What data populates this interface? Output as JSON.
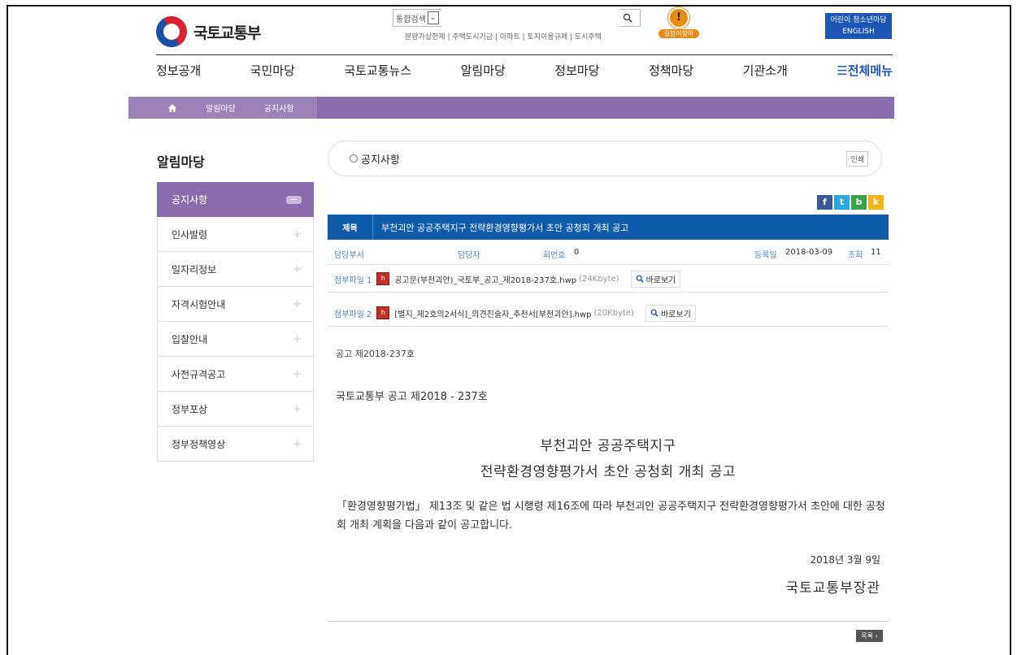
{
  "header": {
    "logo_text": "국토교통부",
    "search_scope": "통합검색",
    "search_placeholder": "",
    "quick_links": "분양가상한제 | 주택도시기금 | 아파트 | 토지이용규제 | 도시주택",
    "badge_label": "길잡이찾아",
    "youth_link": "어린이 청소년마당",
    "english_link": "ENGLISH"
  },
  "nav": [
    "정보공개",
    "국민마당",
    "국토교통뉴스",
    "알림마당",
    "정보마당",
    "정책마당",
    "기관소개"
  ],
  "nav_all": "☰전체메뉴",
  "breadcrumb": [
    "알림마당",
    "공지사항"
  ],
  "sidebar": {
    "title": "알림마당",
    "items": [
      "공지사항",
      "인사발령",
      "일자리정보",
      "자격시험안내",
      "입찰안내",
      "사전규격공고",
      "정부포상",
      "정부정책영상"
    ]
  },
  "content": {
    "section_title": "공지사항",
    "print_label": "인쇄",
    "subject_label": "제목",
    "subject": "부천괴안 공공주택지구 전략환경영향평가서 초안 공청회 개최 공고",
    "dept_label": "담당부서",
    "person_label": "담당자",
    "phone_label": "회번호",
    "phone_value": "0",
    "reg_label": "등록일",
    "reg_date": "2018-03-09",
    "views_label": "조회",
    "views": "11",
    "files": [
      {
        "label": "첨부파일 1",
        "name": "공고문(부천괴안)_국토부_공고_제2018-237호.hwp",
        "size": "(24Kbyte)",
        "view": "바로보기"
      },
      {
        "label": "첨부파일 2",
        "name": "[별지_제2호의2서식]_의견진술자_추천서[부천괴안].hwp",
        "size": "(20Kbyte)",
        "view": "바로보기"
      }
    ],
    "notice_no": "공고 제2018-237호",
    "ministry_notice": "국토교통부 공고 제2018 - 237호",
    "doc_title_1": "부천괴안 공공주택지구",
    "doc_title_2": "전략환경영향평가서 초안 공청회 개최 공고",
    "paragraph": "「환경영향평가법」 제13조 및 같은 법 시행령 제16조에 따라 부천괴안 공공주택지구 전략환경영향평가서 초안에 대한 공청회 개최 계획을 다음과 같이 공고합니다.",
    "date": "2018년 3월 9일",
    "minister": "국토교통부장관",
    "list_button": "목록 ›"
  }
}
